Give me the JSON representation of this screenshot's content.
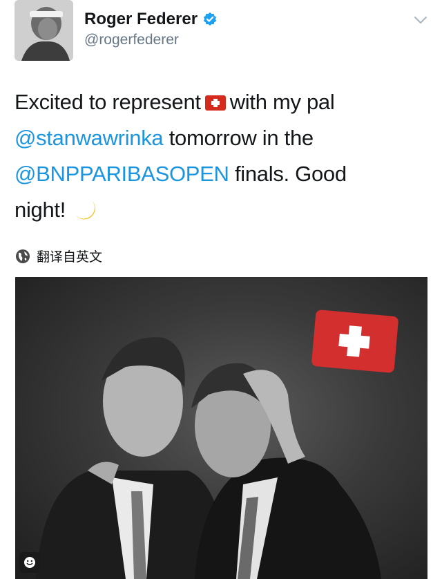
{
  "author": {
    "display_name": "Roger Federer",
    "handle": "@rogerfederer",
    "verified": true
  },
  "tweet": {
    "line1_before_flag": "Excited to represent",
    "flag_emoji": "swiss-flag-emoji",
    "line1_after_flag": "with my pal",
    "mention1": "@stanwawrinka",
    "line2_after": " tomorrow in the",
    "mention2": "@BNPPARIBASOPEN",
    "line3_after": " finals. Good",
    "line4": "night!",
    "moon_emoji": "crescent-moon-emoji"
  },
  "translate": {
    "label": "翻译自英文",
    "icon": "globe-icon"
  },
  "media": {
    "overlay_icon": "swiss-flag-icon",
    "corner_button_icon": "smiley-icon"
  },
  "colors": {
    "link": "#1b95e0",
    "verified": "#1da1f2",
    "secondary_text": "#657786",
    "flag_red": "#d32f2f"
  }
}
